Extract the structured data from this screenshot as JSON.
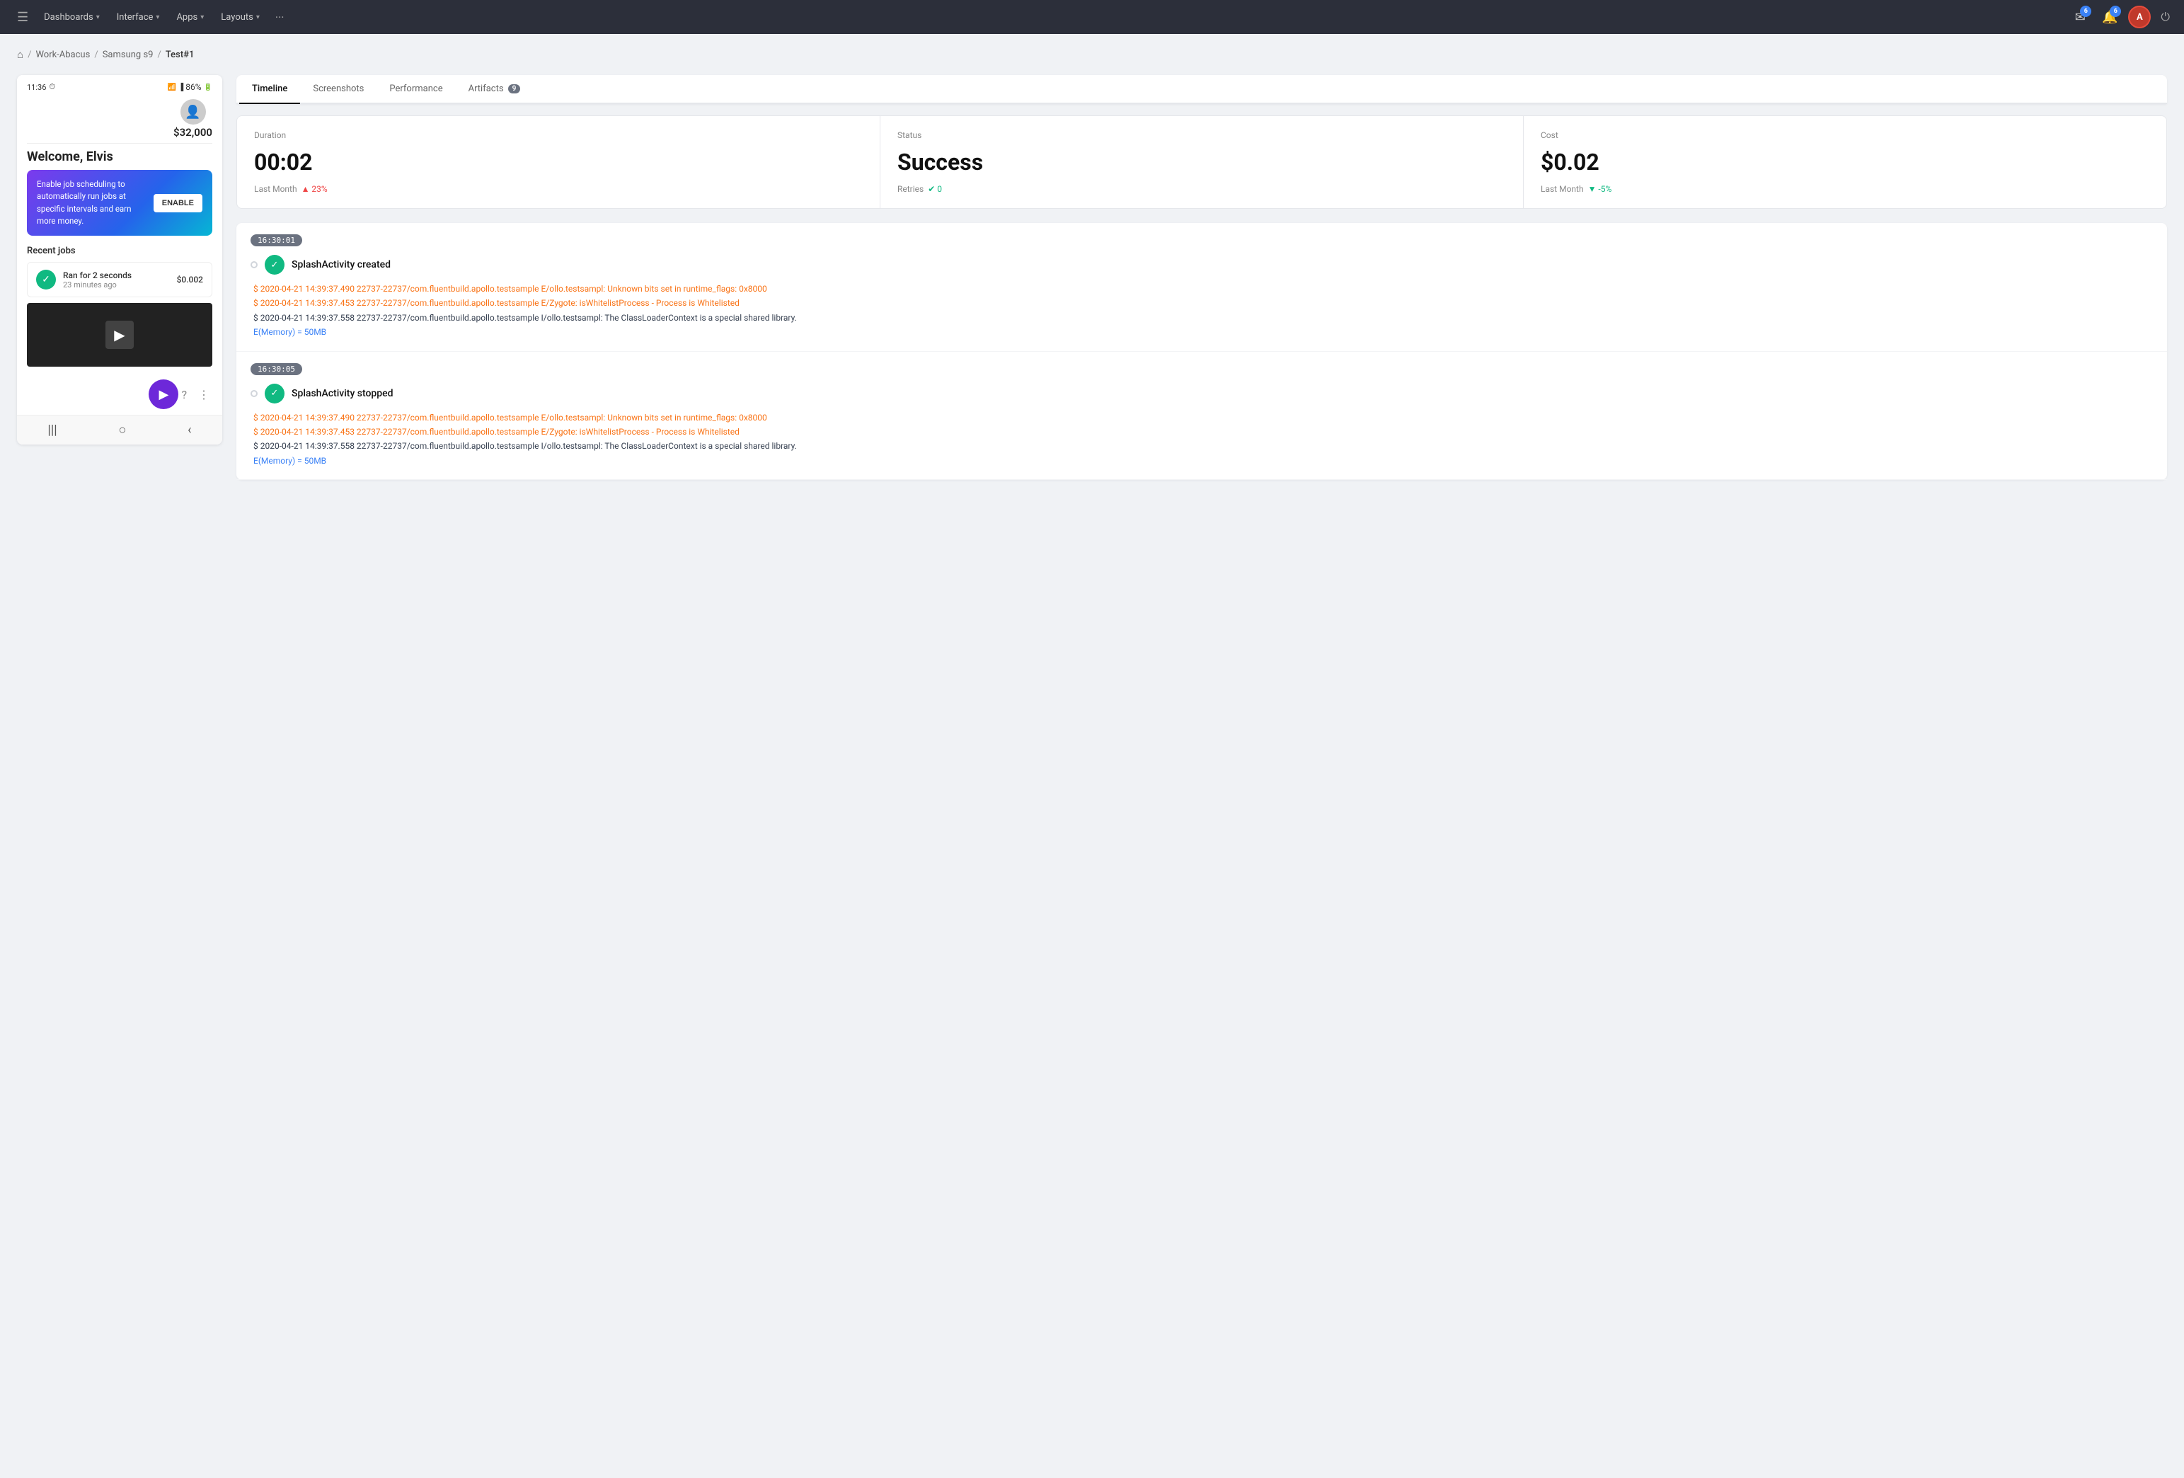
{
  "topnav": {
    "hamburger": "☰",
    "items": [
      {
        "label": "Dashboards",
        "key": "dashboards"
      },
      {
        "label": "Interface",
        "key": "interface"
      },
      {
        "label": "Apps",
        "key": "apps"
      },
      {
        "label": "Layouts",
        "key": "layouts"
      }
    ],
    "more": "···",
    "notifications_count": "6",
    "alerts_count": "6",
    "avatar_initials": "A",
    "power_icon": "⏻"
  },
  "breadcrumb": {
    "home_icon": "⌂",
    "items": [
      {
        "label": "Work-Abacus",
        "key": "work-abacus"
      },
      {
        "label": "Samsung s9",
        "key": "samsung-s9"
      },
      {
        "label": "Test#1",
        "key": "test1"
      }
    ]
  },
  "device": {
    "time": "11:36",
    "battery": "86%",
    "balance": "$32,000",
    "welcome": "Welcome,",
    "username": "Elvis",
    "promo": {
      "text": "Enable job scheduling to automatically run jobs at specific intervals and earn more money.",
      "button_label": "ENABLE"
    },
    "recent_jobs_title": "Recent jobs",
    "job": {
      "title": "Ran for 2 seconds",
      "time": "23 minutes ago",
      "cost": "$0.002"
    },
    "nav_icons": [
      "|||",
      "○",
      "‹"
    ]
  },
  "tabs": [
    {
      "label": "Timeline",
      "key": "timeline",
      "active": true
    },
    {
      "label": "Screenshots",
      "key": "screenshots",
      "active": false
    },
    {
      "label": "Performance",
      "key": "performance",
      "active": false
    },
    {
      "label": "Artifacts",
      "key": "artifacts",
      "active": false,
      "badge": "9"
    }
  ],
  "metrics": [
    {
      "label": "Duration",
      "value": "00:02",
      "footer_label": "Last Month",
      "change": "▲ 23%",
      "change_type": "up"
    },
    {
      "label": "Status",
      "value": "Success",
      "footer_label": "Retries",
      "change": "✔ 0",
      "change_type": "neutral"
    },
    {
      "label": "Cost",
      "value": "$0.02",
      "footer_label": "Last Month",
      "change": "▼ -5%",
      "change_type": "down"
    }
  ],
  "timeline": {
    "events": [
      {
        "timestamp": "16:30:01",
        "title": "SplashActivity created",
        "logs": [
          {
            "type": "orange",
            "text": "$ 2020-04-21 14:39:37.490 22737-22737/com.fluentbuild.apollo.testsample E/ollo.testsampl: Unknown bits set in runtime_flags: 0x8000"
          },
          {
            "type": "orange",
            "text": "$ 2020-04-21 14:39:37.453 22737-22737/com.fluentbuild.apollo.testsample E/Zygote: isWhitelistProcess - Process is Whitelisted"
          },
          {
            "type": "black",
            "text": "$ 2020-04-21 14:39:37.558 22737-22737/com.fluentbuild.apollo.testsample I/ollo.testsampl: The ClassLoaderContext is a special shared library."
          },
          {
            "type": "blue",
            "text": "E(Memory) = 50MB"
          }
        ]
      },
      {
        "timestamp": "16:30:05",
        "title": "SplashActivity stopped",
        "logs": [
          {
            "type": "orange",
            "text": "$ 2020-04-21 14:39:37.490 22737-22737/com.fluentbuild.apollo.testsample E/ollo.testsampl: Unknown bits set in runtime_flags: 0x8000"
          },
          {
            "type": "orange",
            "text": "$ 2020-04-21 14:39:37.453 22737-22737/com.fluentbuild.apollo.testsample E/Zygote: isWhitelistProcess - Process is Whitelisted"
          },
          {
            "type": "black",
            "text": "$ 2020-04-21 14:39:37.558 22737-22737/com.fluentbuild.apollo.testsample I/ollo.testsampl: The ClassLoaderContext is a special shared library."
          },
          {
            "type": "blue",
            "text": "E(Memory) = 50MB"
          }
        ]
      }
    ]
  }
}
